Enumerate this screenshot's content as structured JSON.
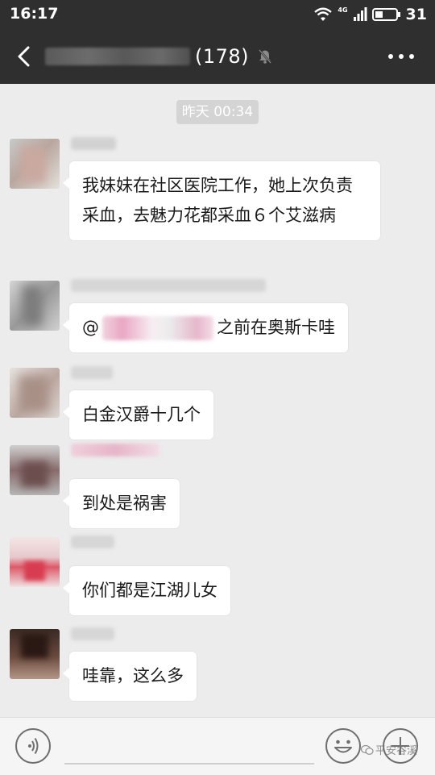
{
  "status_bar": {
    "time": "16:17",
    "network": "4G",
    "battery": "31"
  },
  "header": {
    "member_count": "(178)"
  },
  "timestamp": "昨天 00:34",
  "messages": [
    {
      "text": "我妹妹在社区医院工作，她上次负责采血，去魅力花都采血６个艾滋病"
    },
    {
      "mention_prefix": "@",
      "text": "之前在奥斯卡哇"
    },
    {
      "text": "白金汉爵十几个"
    },
    {
      "text": "到处是祸害"
    },
    {
      "text": "你们都是江湖儿女"
    },
    {
      "text": "哇靠，这么多"
    }
  ],
  "watermark": "平安谷溪",
  "colors": {
    "bar": "#2f2f2f",
    "chat_bg": "#ececec",
    "bubble": "#ffffff"
  }
}
